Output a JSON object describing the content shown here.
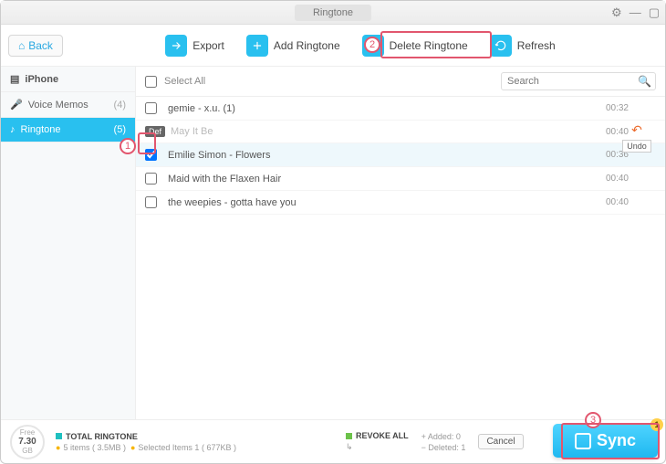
{
  "window": {
    "title": "Ringtone"
  },
  "toolbar": {
    "back": "Back",
    "export": "Export",
    "add": "Add Ringtone",
    "delete": "Delete Ringtone",
    "refresh": "Refresh"
  },
  "sidebar": {
    "device": "iPhone",
    "items": [
      {
        "label": "Voice Memos",
        "count": "(4)"
      },
      {
        "label": "Ringtone",
        "count": "(5)"
      }
    ]
  },
  "list": {
    "selectAll": "Select All",
    "searchPlaceholder": "Search",
    "undo": "Undo",
    "defBadge": "Def",
    "rows": [
      {
        "name": "gemie - x.u. (1)",
        "dur": "00:32",
        "checked": false,
        "deleted": false,
        "selected": false,
        "def": false
      },
      {
        "name": "May It Be",
        "dur": "00:40",
        "checked": false,
        "deleted": true,
        "selected": false,
        "def": true
      },
      {
        "name": "Emilie Simon - Flowers",
        "dur": "00:36",
        "checked": true,
        "deleted": false,
        "selected": true,
        "def": false
      },
      {
        "name": "Maid with the Flaxen Hair",
        "dur": "00:40",
        "checked": false,
        "deleted": false,
        "selected": false,
        "def": false
      },
      {
        "name": "the weepies - gotta have you",
        "dur": "00:40",
        "checked": false,
        "deleted": false,
        "selected": false,
        "def": false
      }
    ]
  },
  "footer": {
    "free": {
      "label": "Free",
      "value": "7.30",
      "unit": "GB"
    },
    "totalTitle": "TOTAL RINGTONE",
    "totalLine": "5 items ( 3.5MB )",
    "selectedLine": "Selected Items 1 ( 677KB )",
    "revokeTitle": "REVOKE ALL",
    "revokeArrow": "↳",
    "added": "Added: 0",
    "deleted": "Deleted: 1",
    "cancel": "Cancel",
    "sync": "Sync",
    "syncBadge": "1"
  },
  "callouts": {
    "c1": "1",
    "c2": "2",
    "c3": "3"
  }
}
